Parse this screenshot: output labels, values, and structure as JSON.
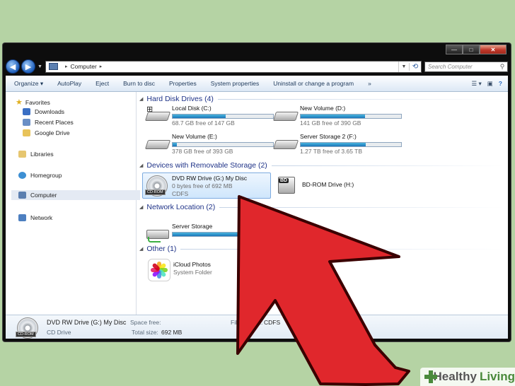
{
  "window": {
    "controls": {
      "minimize": "—",
      "maximize": "□",
      "close": "✕"
    }
  },
  "addressbar": {
    "location": "Computer",
    "search_placeholder": "Search Computer"
  },
  "toolbar": {
    "items": [
      "Organize ▾",
      "AutoPlay",
      "Eject",
      "Burn to disc",
      "Properties",
      "System properties",
      "Uninstall or change a program",
      "»"
    ]
  },
  "sidebar": {
    "favorites": "Favorites",
    "downloads": "Downloads",
    "recent_places": "Recent Places",
    "google_drive": "Google Drive",
    "libraries": "Libraries",
    "homegroup": "Homegroup",
    "computer": "Computer",
    "network": "Network"
  },
  "groups": {
    "hdd": {
      "header": "Hard Disk Drives (4)",
      "drives": [
        {
          "name": "Local Disk (C:)",
          "free": "68.7 GB free of 147 GB",
          "used_fraction": 0.53
        },
        {
          "name": "New Volume (D:)",
          "free": "141 GB free of 390 GB",
          "used_fraction": 0.64
        },
        {
          "name": "New Volume (E:)",
          "free": "378 GB free of 393 GB",
          "used_fraction": 0.04
        },
        {
          "name": "Server Storage 2 (F:)",
          "free": "1.27 TB free of 3.65 TB",
          "used_fraction": 0.65
        }
      ]
    },
    "removable": {
      "header": "Devices with Removable Storage (2)",
      "dvd": {
        "name": "DVD RW Drive (G:) My Disc",
        "free": "0 bytes free of 692 MB",
        "fs": "CDFS",
        "tag": "CD-ROM"
      },
      "bd": {
        "name": "BD-ROM Drive (H:)",
        "tag": "BD"
      }
    },
    "network": {
      "header": "Network Location (2)",
      "drive": {
        "name": "Server Storage",
        "used_fraction": 0.96
      }
    },
    "other": {
      "header": "Other (1)",
      "item": {
        "name": "iCloud Photos",
        "sub": "System Folder"
      }
    }
  },
  "statusbar": {
    "name": "DVD RW Drive (G:) My Disc",
    "type": "CD Drive",
    "space_free_label": "Space free:",
    "total_size_label": "Total size:",
    "total_size": "692 MB",
    "fs_label": "File system:",
    "fs": "CDFS",
    "tag": "CD-ROM"
  },
  "watermark": {
    "brand_a": "Healthy",
    "brand_b": "Living"
  },
  "colors": {
    "arrow": "#e0272c",
    "accent": "#1e3287",
    "background": "#b5d3a4"
  }
}
